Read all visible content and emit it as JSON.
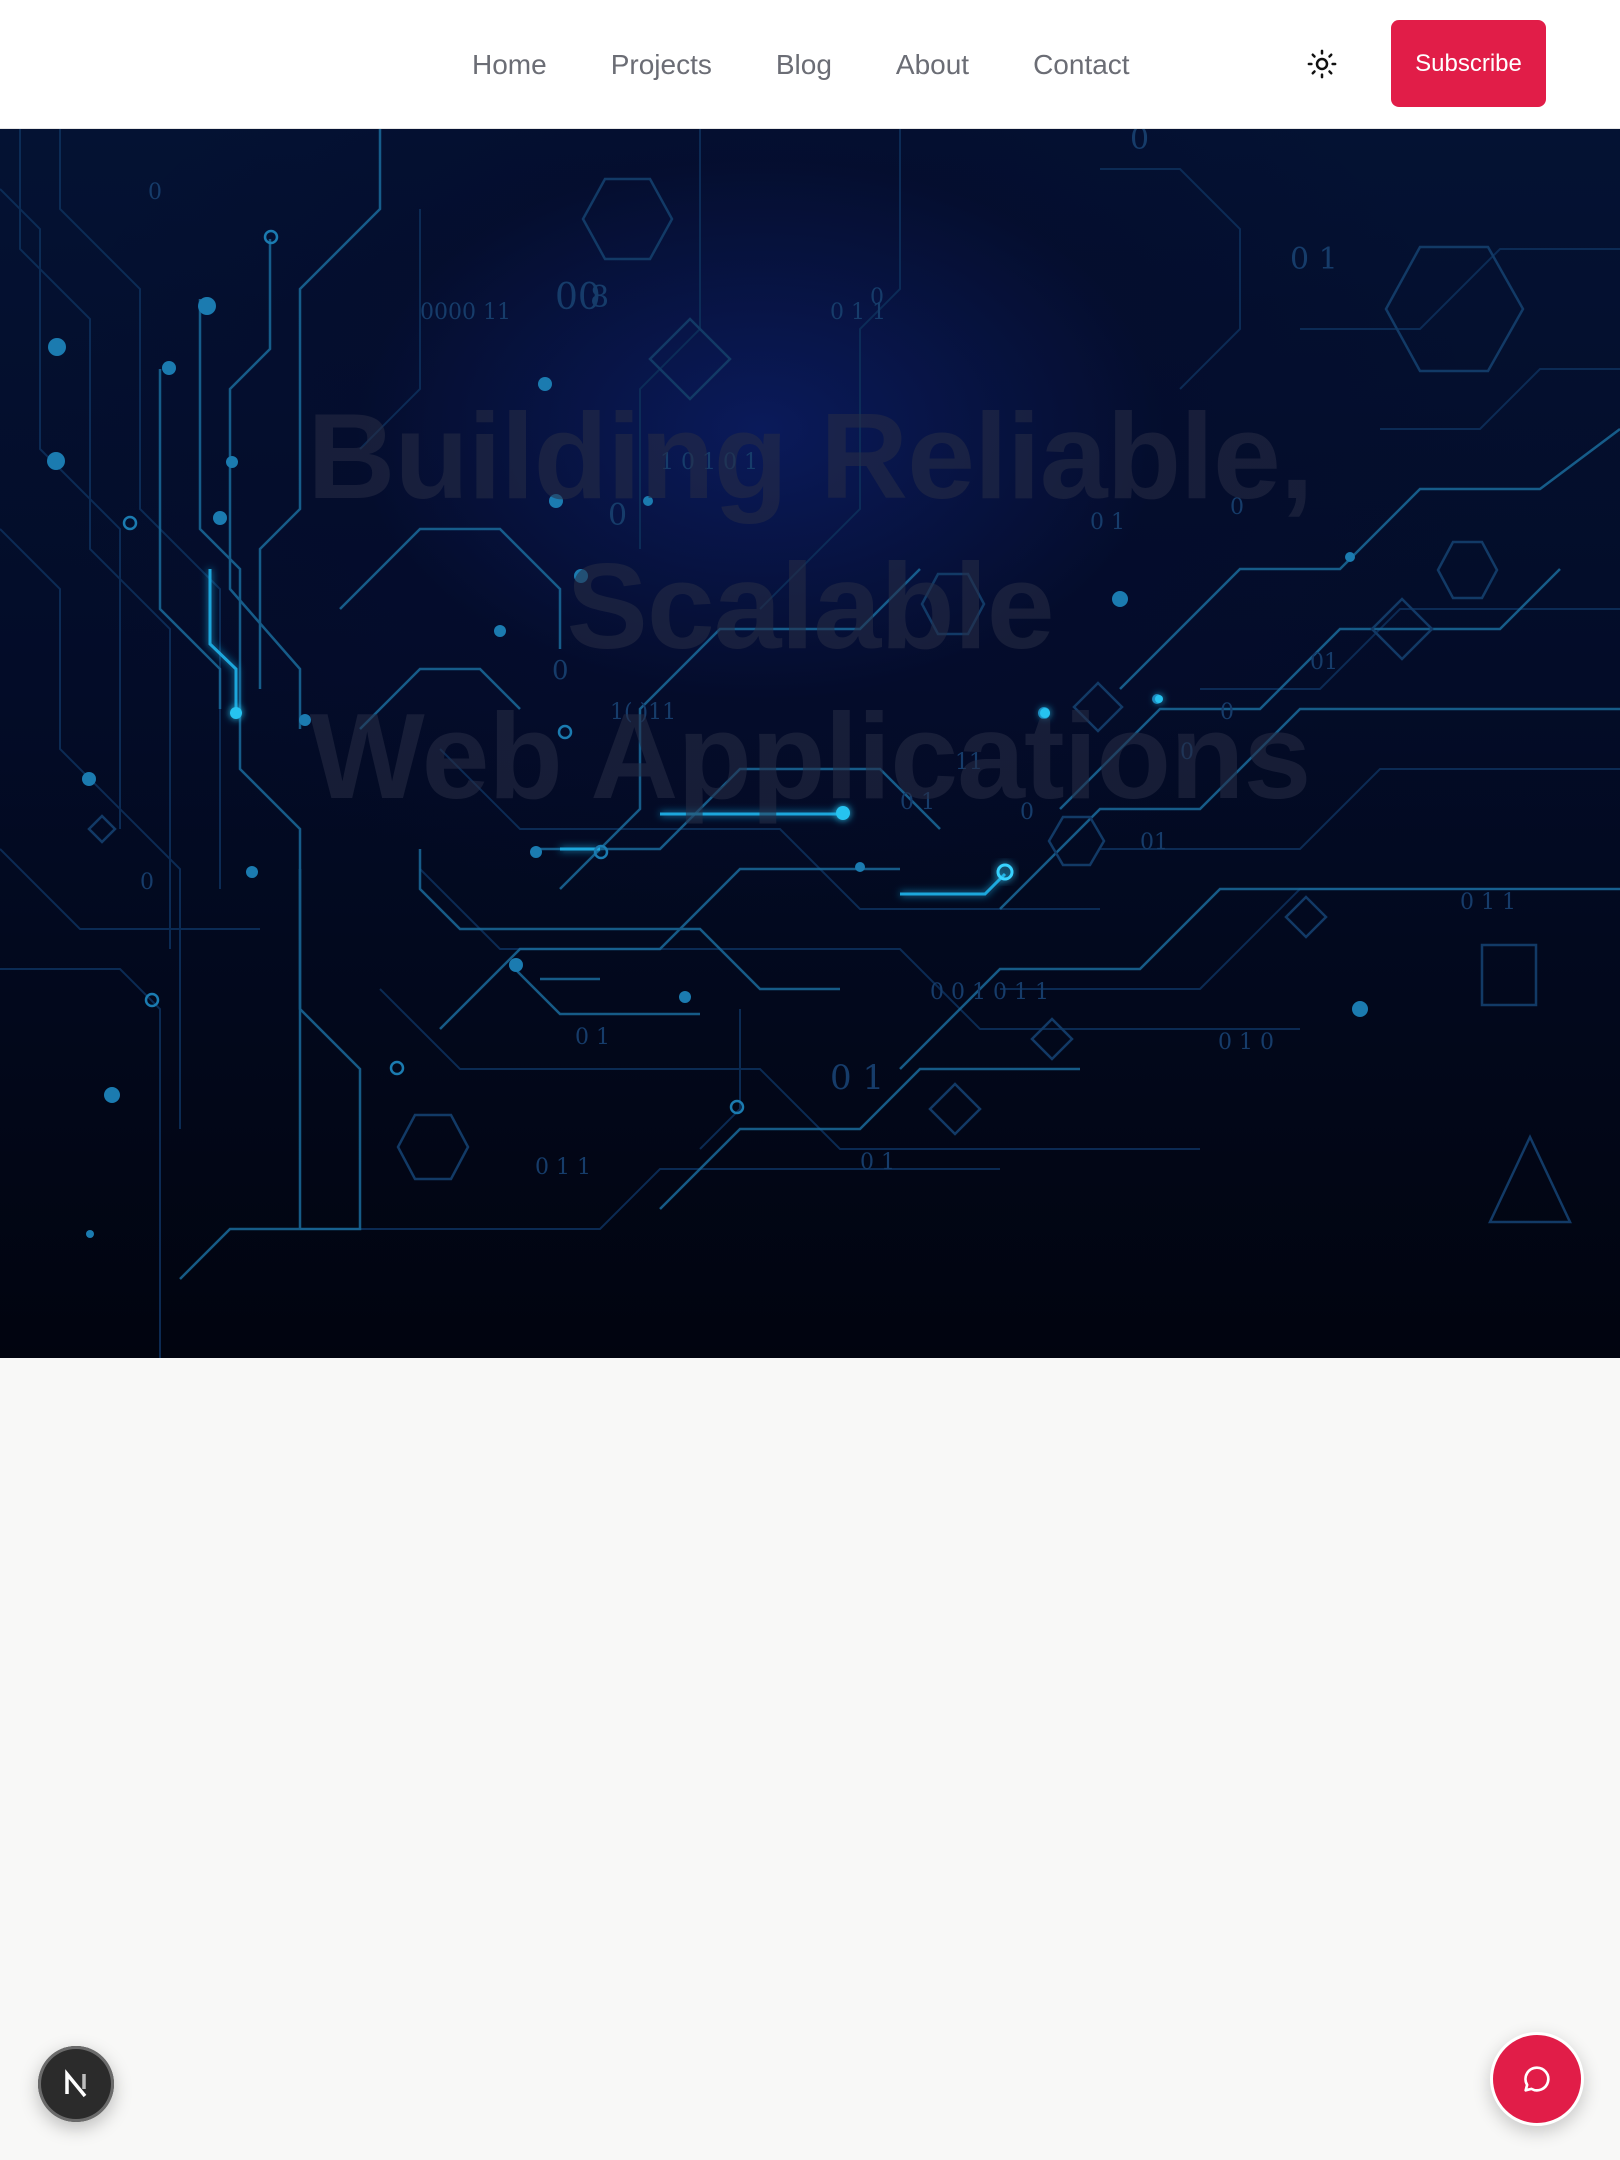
{
  "nav": {
    "items": [
      {
        "label": "Home"
      },
      {
        "label": "Projects"
      },
      {
        "label": "Blog"
      },
      {
        "label": "About"
      },
      {
        "label": "Contact"
      }
    ],
    "theme_toggle_icon": "sun-icon",
    "subscribe_label": "Subscribe"
  },
  "hero": {
    "title_line1": "Building Reliable, Scalable",
    "title_line2": "Web Applications",
    "background_image": "circuit-board-illustration"
  },
  "floating": {
    "next_badge_letter": "N",
    "chat_icon": "chat-bubble-icon"
  },
  "colors": {
    "accent": "#e11d48",
    "nav_text": "#6b6d75",
    "hero_bg": "#030c28",
    "circuit_glow": "#19b6e6",
    "page_bg": "#f8f8f7"
  }
}
